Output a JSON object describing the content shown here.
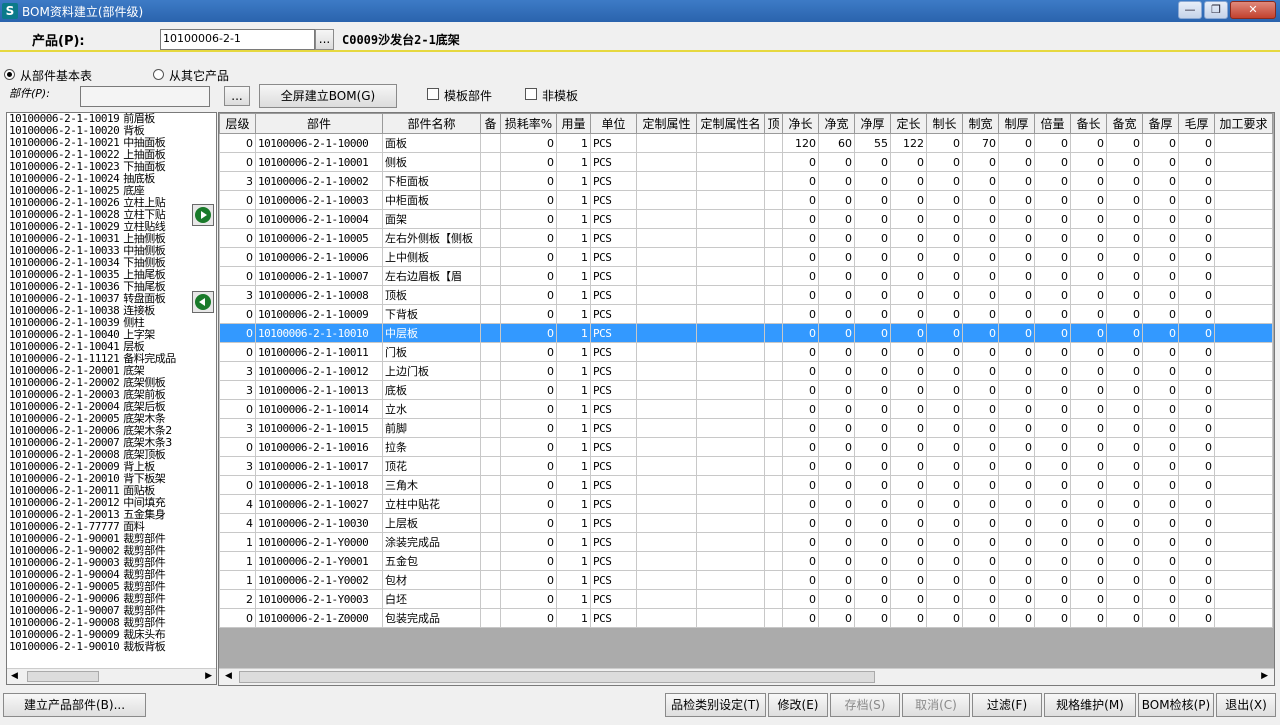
{
  "window": {
    "title": "BOM资料建立(部件级)",
    "icon": "S"
  },
  "product": {
    "label": "产品(P):",
    "code": "10100006-2-1",
    "browse": "...",
    "description": "C0009沙发台2-1底架"
  },
  "source": {
    "from_base": "从部件基本表",
    "from_other": "从其它产品",
    "part_label": "部件(P):",
    "part_value": "",
    "browse": "...",
    "full_screen_btn": "全屏建立BOM(G)",
    "template_part": "模板部件",
    "non_template": "非模板"
  },
  "part_list": [
    {
      "code": "10100006-2-1-10019",
      "name": "前眉板"
    },
    {
      "code": "10100006-2-1-10020",
      "name": "背板"
    },
    {
      "code": "10100006-2-1-10021",
      "name": "中抽面板"
    },
    {
      "code": "10100006-2-1-10022",
      "name": "上抽面板"
    },
    {
      "code": "10100006-2-1-10023",
      "name": "下抽面板"
    },
    {
      "code": "10100006-2-1-10024",
      "name": "抽底板"
    },
    {
      "code": "10100006-2-1-10025",
      "name": "底座"
    },
    {
      "code": "10100006-2-1-10026",
      "name": "立柱上贴"
    },
    {
      "code": "10100006-2-1-10028",
      "name": "立柱下贴"
    },
    {
      "code": "10100006-2-1-10029",
      "name": "立柱贴线"
    },
    {
      "code": "10100006-2-1-10031",
      "name": "上抽侧板"
    },
    {
      "code": "10100006-2-1-10033",
      "name": "中抽侧板"
    },
    {
      "code": "10100006-2-1-10034",
      "name": "下抽侧板"
    },
    {
      "code": "10100006-2-1-10035",
      "name": "上抽尾板"
    },
    {
      "code": "10100006-2-1-10036",
      "name": "下抽尾板"
    },
    {
      "code": "10100006-2-1-10037",
      "name": "转盘面板"
    },
    {
      "code": "10100006-2-1-10038",
      "name": "连接板"
    },
    {
      "code": "10100006-2-1-10039",
      "name": "侧柱"
    },
    {
      "code": "10100006-2-1-10040",
      "name": "上字架"
    },
    {
      "code": "10100006-2-1-10041",
      "name": "层板"
    },
    {
      "code": "10100006-2-1-11121",
      "name": "备料完成品"
    },
    {
      "code": "10100006-2-1-20001",
      "name": "底架"
    },
    {
      "code": "10100006-2-1-20002",
      "name": "底架侧板"
    },
    {
      "code": "10100006-2-1-20003",
      "name": "底架前板"
    },
    {
      "code": "10100006-2-1-20004",
      "name": "底架后板"
    },
    {
      "code": "10100006-2-1-20005",
      "name": "底架木条"
    },
    {
      "code": "10100006-2-1-20006",
      "name": "底架木条2"
    },
    {
      "code": "10100006-2-1-20007",
      "name": "底架木条3"
    },
    {
      "code": "10100006-2-1-20008",
      "name": "底架顶板"
    },
    {
      "code": "10100006-2-1-20009",
      "name": "背上板"
    },
    {
      "code": "10100006-2-1-20010",
      "name": "背下板架"
    },
    {
      "code": "10100006-2-1-20011",
      "name": "面贴板"
    },
    {
      "code": "10100006-2-1-20012",
      "name": "中间填充"
    },
    {
      "code": "10100006-2-1-20013",
      "name": "五金集身"
    },
    {
      "code": "10100006-2-1-77777",
      "name": "面料"
    },
    {
      "code": "10100006-2-1-90001",
      "name": "裁剪部件"
    },
    {
      "code": "10100006-2-1-90002",
      "name": "裁剪部件"
    },
    {
      "code": "10100006-2-1-90003",
      "name": "裁剪部件"
    },
    {
      "code": "10100006-2-1-90004",
      "name": "裁剪部件"
    },
    {
      "code": "10100006-2-1-90005",
      "name": "裁剪部件"
    },
    {
      "code": "10100006-2-1-90006",
      "name": "裁剪部件"
    },
    {
      "code": "10100006-2-1-90007",
      "name": "裁剪部件"
    },
    {
      "code": "10100006-2-1-90008",
      "name": "裁剪部件"
    },
    {
      "code": "10100006-2-1-90009",
      "name": "裁床头布"
    },
    {
      "code": "10100006-2-1-90010",
      "name": "裁板背板"
    }
  ],
  "grid": {
    "headers": [
      "层级",
      "部件",
      "部件名称",
      "备",
      "损耗率%",
      "用量",
      "单位",
      "定制属性",
      "定制属性名",
      "顶",
      "净长",
      "净宽",
      "净厚",
      "定长",
      "制长",
      "制宽",
      "制厚",
      "倍量",
      "备长",
      "备宽",
      "备厚",
      "毛厚",
      "加工要求"
    ],
    "rows": [
      [
        "0",
        "10100006-2-1-10000",
        "面板",
        "",
        "0",
        "1",
        "PCS",
        "",
        "",
        "",
        "120",
        "60",
        "55",
        "122",
        "0",
        "70",
        "0",
        "0",
        "0",
        "0",
        "0",
        "0",
        ""
      ],
      [
        "0",
        "10100006-2-1-10001",
        "侧板",
        "",
        "0",
        "1",
        "PCS",
        "",
        "",
        "",
        "0",
        "0",
        "0",
        "0",
        "0",
        "0",
        "0",
        "0",
        "0",
        "0",
        "0",
        "0",
        ""
      ],
      [
        "3",
        "10100006-2-1-10002",
        "下柜面板",
        "",
        "0",
        "1",
        "PCS",
        "",
        "",
        "",
        "0",
        "0",
        "0",
        "0",
        "0",
        "0",
        "0",
        "0",
        "0",
        "0",
        "0",
        "0",
        ""
      ],
      [
        "0",
        "10100006-2-1-10003",
        "中柜面板",
        "",
        "0",
        "1",
        "PCS",
        "",
        "",
        "",
        "0",
        "0",
        "0",
        "0",
        "0",
        "0",
        "0",
        "0",
        "0",
        "0",
        "0",
        "0",
        ""
      ],
      [
        "0",
        "10100006-2-1-10004",
        "面架",
        "",
        "0",
        "1",
        "PCS",
        "",
        "",
        "",
        "0",
        "0",
        "0",
        "0",
        "0",
        "0",
        "0",
        "0",
        "0",
        "0",
        "0",
        "0",
        ""
      ],
      [
        "0",
        "10100006-2-1-10005",
        "左右外侧板【侧板",
        "",
        "0",
        "1",
        "PCS",
        "",
        "",
        "",
        "0",
        "0",
        "0",
        "0",
        "0",
        "0",
        "0",
        "0",
        "0",
        "0",
        "0",
        "0",
        ""
      ],
      [
        "0",
        "10100006-2-1-10006",
        "上中侧板",
        "",
        "0",
        "1",
        "PCS",
        "",
        "",
        "",
        "0",
        "0",
        "0",
        "0",
        "0",
        "0",
        "0",
        "0",
        "0",
        "0",
        "0",
        "0",
        ""
      ],
      [
        "0",
        "10100006-2-1-10007",
        "左右边眉板【眉",
        "",
        "0",
        "1",
        "PCS",
        "",
        "",
        "",
        "0",
        "0",
        "0",
        "0",
        "0",
        "0",
        "0",
        "0",
        "0",
        "0",
        "0",
        "0",
        ""
      ],
      [
        "3",
        "10100006-2-1-10008",
        "顶板",
        "",
        "0",
        "1",
        "PCS",
        "",
        "",
        "",
        "0",
        "0",
        "0",
        "0",
        "0",
        "0",
        "0",
        "0",
        "0",
        "0",
        "0",
        "0",
        ""
      ],
      [
        "0",
        "10100006-2-1-10009",
        "下背板",
        "",
        "0",
        "1",
        "PCS",
        "",
        "",
        "",
        "0",
        "0",
        "0",
        "0",
        "0",
        "0",
        "0",
        "0",
        "0",
        "0",
        "0",
        "0",
        ""
      ],
      [
        "0",
        "10100006-2-1-10010",
        "中层板",
        "",
        "0",
        "1",
        "PCS",
        "",
        "",
        "",
        "0",
        "0",
        "0",
        "0",
        "0",
        "0",
        "0",
        "0",
        "0",
        "0",
        "0",
        "0",
        ""
      ],
      [
        "0",
        "10100006-2-1-10011",
        "门板",
        "",
        "0",
        "1",
        "PCS",
        "",
        "",
        "",
        "0",
        "0",
        "0",
        "0",
        "0",
        "0",
        "0",
        "0",
        "0",
        "0",
        "0",
        "0",
        ""
      ],
      [
        "3",
        "10100006-2-1-10012",
        "上边门板",
        "",
        "0",
        "1",
        "PCS",
        "",
        "",
        "",
        "0",
        "0",
        "0",
        "0",
        "0",
        "0",
        "0",
        "0",
        "0",
        "0",
        "0",
        "0",
        ""
      ],
      [
        "3",
        "10100006-2-1-10013",
        "底板",
        "",
        "0",
        "1",
        "PCS",
        "",
        "",
        "",
        "0",
        "0",
        "0",
        "0",
        "0",
        "0",
        "0",
        "0",
        "0",
        "0",
        "0",
        "0",
        ""
      ],
      [
        "0",
        "10100006-2-1-10014",
        "立水",
        "",
        "0",
        "1",
        "PCS",
        "",
        "",
        "",
        "0",
        "0",
        "0",
        "0",
        "0",
        "0",
        "0",
        "0",
        "0",
        "0",
        "0",
        "0",
        ""
      ],
      [
        "3",
        "10100006-2-1-10015",
        "前脚",
        "",
        "0",
        "1",
        "PCS",
        "",
        "",
        "",
        "0",
        "0",
        "0",
        "0",
        "0",
        "0",
        "0",
        "0",
        "0",
        "0",
        "0",
        "0",
        ""
      ],
      [
        "0",
        "10100006-2-1-10016",
        "拉条",
        "",
        "0",
        "1",
        "PCS",
        "",
        "",
        "",
        "0",
        "0",
        "0",
        "0",
        "0",
        "0",
        "0",
        "0",
        "0",
        "0",
        "0",
        "0",
        ""
      ],
      [
        "3",
        "10100006-2-1-10017",
        "顶花",
        "",
        "0",
        "1",
        "PCS",
        "",
        "",
        "",
        "0",
        "0",
        "0",
        "0",
        "0",
        "0",
        "0",
        "0",
        "0",
        "0",
        "0",
        "0",
        ""
      ],
      [
        "0",
        "10100006-2-1-10018",
        "三角木",
        "",
        "0",
        "1",
        "PCS",
        "",
        "",
        "",
        "0",
        "0",
        "0",
        "0",
        "0",
        "0",
        "0",
        "0",
        "0",
        "0",
        "0",
        "0",
        ""
      ],
      [
        "4",
        "10100006-2-1-10027",
        "立柱中贴花",
        "",
        "0",
        "1",
        "PCS",
        "",
        "",
        "",
        "0",
        "0",
        "0",
        "0",
        "0",
        "0",
        "0",
        "0",
        "0",
        "0",
        "0",
        "0",
        ""
      ],
      [
        "4",
        "10100006-2-1-10030",
        "上层板",
        "",
        "0",
        "1",
        "PCS",
        "",
        "",
        "",
        "0",
        "0",
        "0",
        "0",
        "0",
        "0",
        "0",
        "0",
        "0",
        "0",
        "0",
        "0",
        ""
      ],
      [
        "1",
        "10100006-2-1-Y0000",
        "涂装完成品",
        "",
        "0",
        "1",
        "PCS",
        "",
        "",
        "",
        "0",
        "0",
        "0",
        "0",
        "0",
        "0",
        "0",
        "0",
        "0",
        "0",
        "0",
        "0",
        ""
      ],
      [
        "1",
        "10100006-2-1-Y0001",
        "五金包",
        "",
        "0",
        "1",
        "PCS",
        "",
        "",
        "",
        "0",
        "0",
        "0",
        "0",
        "0",
        "0",
        "0",
        "0",
        "0",
        "0",
        "0",
        "0",
        ""
      ],
      [
        "1",
        "10100006-2-1-Y0002",
        "包材",
        "",
        "0",
        "1",
        "PCS",
        "",
        "",
        "",
        "0",
        "0",
        "0",
        "0",
        "0",
        "0",
        "0",
        "0",
        "0",
        "0",
        "0",
        "0",
        ""
      ],
      [
        "2",
        "10100006-2-1-Y0003",
        "白坯",
        "",
        "0",
        "1",
        "PCS",
        "",
        "",
        "",
        "0",
        "0",
        "0",
        "0",
        "0",
        "0",
        "0",
        "0",
        "0",
        "0",
        "0",
        "0",
        ""
      ],
      [
        "0",
        "10100006-2-1-Z0000",
        "包装完成品",
        "",
        "0",
        "1",
        "PCS",
        "",
        "",
        "",
        "0",
        "0",
        "0",
        "0",
        "0",
        "0",
        "0",
        "0",
        "0",
        "0",
        "0",
        "0",
        ""
      ]
    ],
    "selected_row": 10
  },
  "buttons": {
    "build_part": "建立产品部件(B)...",
    "qc_category": "品检类别设定(T)",
    "modify": "修改(E)",
    "save": "存档(S)",
    "cancel": "取消(C)",
    "filter": "过滤(F)",
    "spec": "规格维护(M)",
    "bom_check": "BOM检核(P)",
    "exit": "退出(X)"
  },
  "colors": {
    "title_bar": "#2f6db8",
    "selection": "#3399ff",
    "rule_yellow": "#e6d840",
    "arrow_green": "#197a2a"
  }
}
